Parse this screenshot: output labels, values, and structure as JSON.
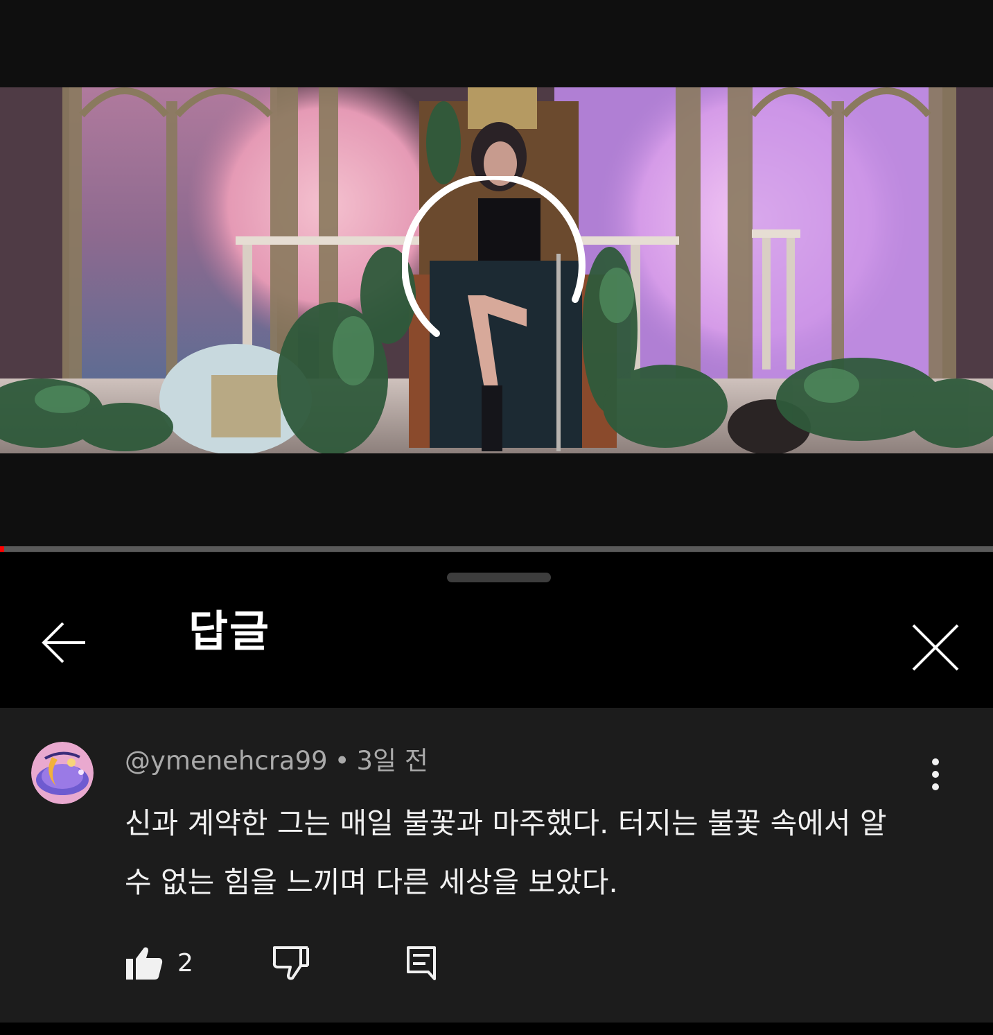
{
  "player": {
    "progress_fraction": 0.004,
    "state": "loading"
  },
  "header": {
    "title": "답글",
    "back_icon": "arrow-left-icon",
    "close_icon": "close-icon"
  },
  "comment": {
    "author": "@ymenehcra99",
    "separator": "•",
    "time": "3일 전",
    "text": "신과 계약한 그는 매일 불꽃과 마주했다. 터지는 불꽃 속에서 알 수 없는 힘을 느끼며 다른 세상을 보았다.",
    "likes": "2",
    "more_icon": "more-vertical-icon",
    "like_icon": "thumbs-up-icon",
    "dislike_icon": "thumbs-down-icon",
    "reply_icon": "reply-icon"
  },
  "colors": {
    "progress": "#ff0000",
    "sheet_bg": "#000000",
    "comment_bg": "#1c1c1c",
    "meta_text": "#aaaaaa"
  }
}
